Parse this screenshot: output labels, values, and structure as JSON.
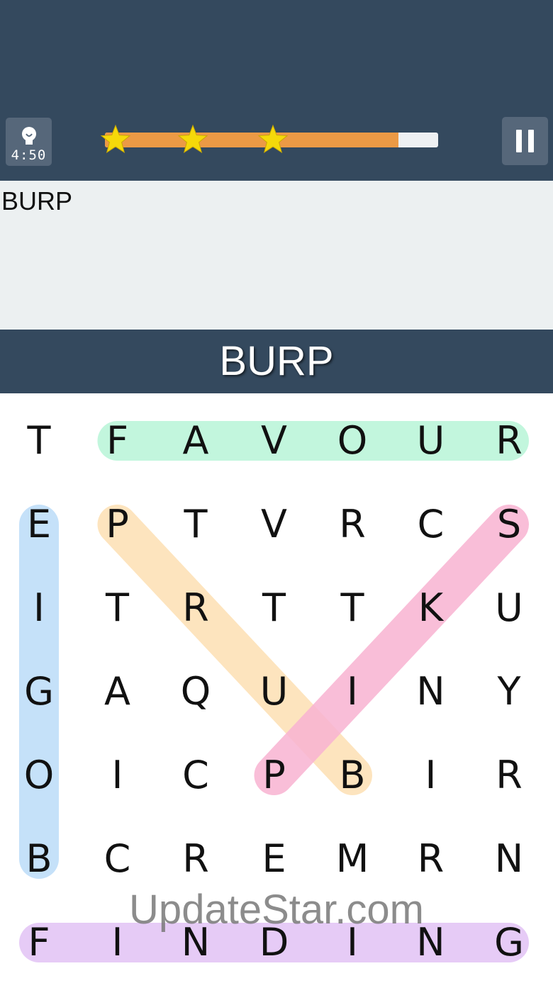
{
  "header": {
    "timer": "4:50",
    "progress": 0.88,
    "stars_earned": 3,
    "star_color": "#f5d90a",
    "progress_color": "#ec9a45"
  },
  "found_words": [
    "BURP"
  ],
  "current_word": "BURP",
  "grid": {
    "rows": [
      [
        "T",
        "F",
        "A",
        "V",
        "O",
        "U",
        "R"
      ],
      [
        "E",
        "P",
        "T",
        "V",
        "R",
        "C",
        "S"
      ],
      [
        "I",
        "T",
        "R",
        "T",
        "T",
        "K",
        "U"
      ],
      [
        "G",
        "A",
        "Q",
        "U",
        "I",
        "N",
        "Y"
      ],
      [
        "O",
        "I",
        "C",
        "P",
        "B",
        "I",
        "R"
      ],
      [
        "B",
        "C",
        "R",
        "E",
        "M",
        "R",
        "N"
      ],
      [
        "F",
        "I",
        "N",
        "D",
        "I",
        "N",
        "G"
      ]
    ]
  },
  "highlights": [
    {
      "word": "FAVOUR",
      "from": [
        0,
        1
      ],
      "to": [
        0,
        6
      ],
      "color": "#b8f5d8"
    },
    {
      "word": "BOGIE",
      "from": [
        5,
        0
      ],
      "to": [
        1,
        0
      ],
      "color": "#bcdcf8"
    },
    {
      "word": "PRUB",
      "from": [
        1,
        1
      ],
      "to": [
        4,
        4
      ],
      "color": "#fde0b3"
    },
    {
      "word": "PIKS",
      "from": [
        4,
        3
      ],
      "to": [
        1,
        6
      ],
      "color": "#f9b3d2"
    },
    {
      "word": "FINDING",
      "from": [
        6,
        0
      ],
      "to": [
        6,
        6
      ],
      "color": "#e2c2f5"
    }
  ],
  "watermark": "UpdateStar.com"
}
